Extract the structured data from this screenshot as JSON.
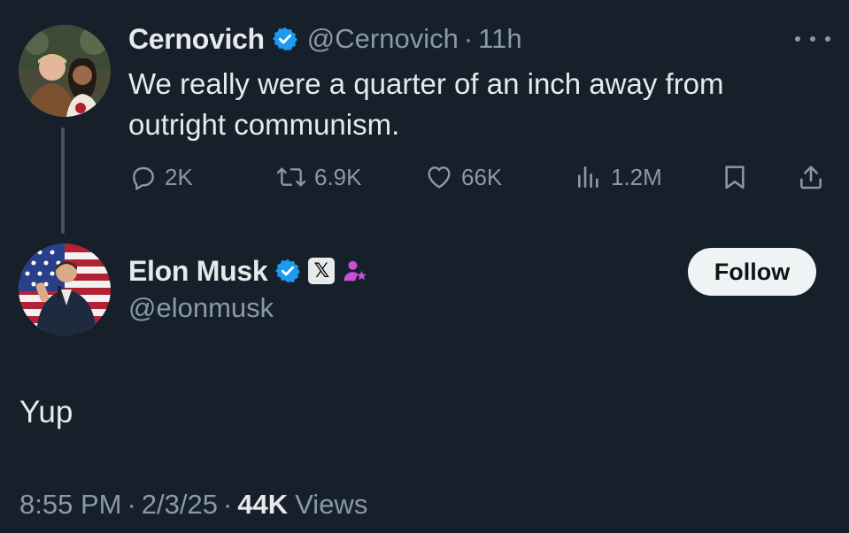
{
  "parent_tweet": {
    "author_name": "Cernovich",
    "handle": "@Cernovich",
    "separator": "·",
    "time": "11h",
    "text": "We really were a quarter of an inch away from outright communism.",
    "actions": {
      "replies": "2K",
      "reposts": "6.9K",
      "likes": "66K",
      "views": "1.2M"
    },
    "icons": [
      "reply-icon",
      "repost-icon",
      "like-icon",
      "views-icon",
      "bookmark-icon",
      "share-icon",
      "more-icon"
    ]
  },
  "main_tweet": {
    "author_name": "Elon Musk",
    "handle": "@elonmusk",
    "affiliate_badge": "𝕏",
    "follow_label": "Follow",
    "text": "Yup",
    "timestamp_time": "8:55 PM",
    "separator": "·",
    "timestamp_date": "2/3/25",
    "views_count": "44K",
    "views_label": "Views"
  },
  "colors": {
    "background": "#15202b",
    "text_primary": "#e7e9ea",
    "text_secondary": "#8b98a5",
    "verified_blue": "#1d9bf0",
    "follow_bg": "#eff3f4",
    "affiliate_purple": "#c94fd8"
  }
}
